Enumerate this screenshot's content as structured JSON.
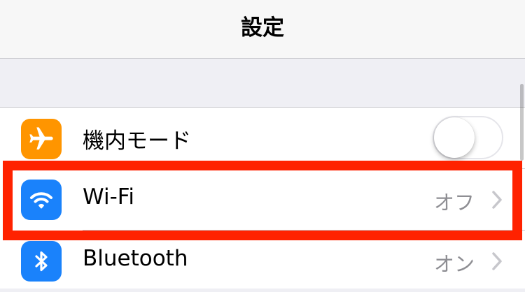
{
  "navbar": {
    "title": "設定"
  },
  "settings": {
    "items": [
      {
        "label": "機内モード",
        "icon": "airplane-icon",
        "icon_color": "#ff9500",
        "control": "toggle",
        "toggle_on": false
      },
      {
        "label": "Wi-Fi",
        "icon": "wifi-icon",
        "icon_color": "#1a82fb",
        "value": "オフ",
        "control": "disclosure"
      },
      {
        "label": "Bluetooth",
        "icon": "bluetooth-icon",
        "icon_color": "#1a82fb",
        "value": "オン",
        "control": "disclosure"
      }
    ]
  },
  "highlight_color": "#ff2200"
}
